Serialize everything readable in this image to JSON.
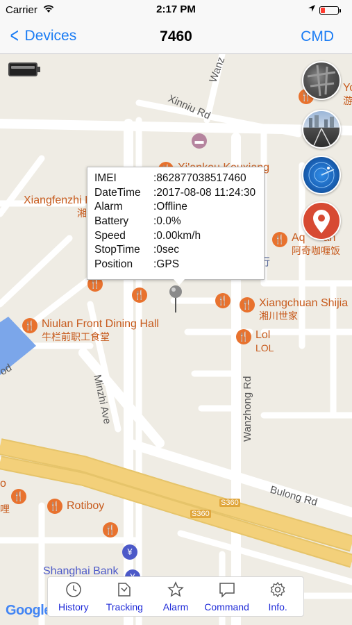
{
  "status_bar": {
    "carrier": "Carrier",
    "time": "2:17 PM"
  },
  "nav": {
    "back_label": "Devices",
    "title": "7460",
    "right_label": "CMD"
  },
  "info_window": {
    "rows": [
      {
        "key": "IMEI",
        "value": ":862877038517460"
      },
      {
        "key": "DateTime",
        "value": ":2017-08-08 11:24:30"
      },
      {
        "key": "Alarm",
        "value": ":Offline"
      },
      {
        "key": "Battery",
        "value": ":0.0%"
      },
      {
        "key": "Speed",
        "value": ":0.00km/h"
      },
      {
        "key": "StopTime",
        "value": ":0sec"
      },
      {
        "key": "Position",
        "value": ":GPS"
      }
    ]
  },
  "map_labels": {
    "wanz": "Wanz",
    "xinniu_rd": "Xinniu Rd",
    "xiankou": "Xi'ankou Kouxiang",
    "xiangfenzhi": "Xiangfenzhi H",
    "xiangfenzhi_zh": "湘",
    "aq": "Aq",
    "aq_tail": "an",
    "aq_zh": "阿奇咖喱饭",
    "hang_zh": "行",
    "xiangchuan": "Xiangchuan Shijia",
    "xiangchuan_zh": "湘川世家",
    "niulan": "Niulan Front Dining Hall",
    "niulan_zh": "牛栏前职工食堂",
    "lol": "Lol",
    "lol_zh": "LOL",
    "minzhi_ave": "Minzhi Ave",
    "wanzhong_rd": "Wanzhong Rd",
    "bulong_rd": "Bulong Rd",
    "s360_a": "S360",
    "s360_b": "S360",
    "rotiboy": "Rotiboy",
    "shanghai_bank": "Shanghai Bank",
    "yo": "Yo",
    "you_zh": "游",
    "edge_o": "o",
    "edge_li": "哩",
    "edge_od": "od"
  },
  "google_logo": "Google",
  "toolbar": {
    "items": [
      {
        "label": "History",
        "icon": "clock-icon"
      },
      {
        "label": "Tracking",
        "icon": "tracking-icon"
      },
      {
        "label": "Alarm",
        "icon": "star-icon"
      },
      {
        "label": "Command",
        "icon": "chat-icon"
      },
      {
        "label": "Info.",
        "icon": "gear-icon"
      }
    ]
  },
  "colors": {
    "accent": "#1a7cf4",
    "toolbar_text": "#1e2ad8",
    "poi": "#e8722e",
    "highway": "#f3d07a",
    "map_bg": "#efece4"
  }
}
